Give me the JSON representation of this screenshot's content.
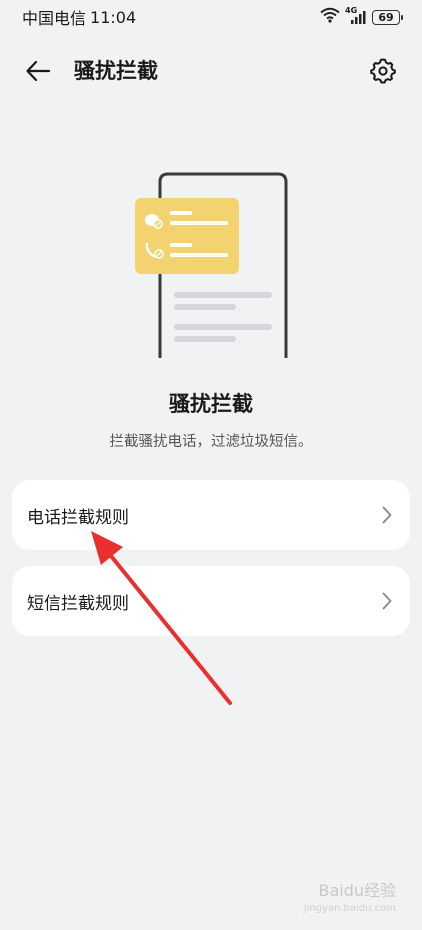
{
  "status_bar": {
    "carrier": "中国电信",
    "time": "11:04",
    "network": "4G",
    "battery": "69"
  },
  "app_bar": {
    "title": "骚扰拦截"
  },
  "hero": {
    "title": "骚扰拦截",
    "subtitle": "拦截骚扰电话，过滤垃圾短信。"
  },
  "menu": {
    "items": [
      {
        "label": "电话拦截规则"
      },
      {
        "label": "短信拦截规则"
      }
    ]
  },
  "watermark": {
    "brand": "Baidu经验",
    "url": "jingyan.baidu.com"
  },
  "colors": {
    "background": "#f1f2f4",
    "card": "#ffffff",
    "illustration_accent": "#f2d370",
    "annotation_arrow": "#e8312f"
  },
  "icons": [
    "back-arrow-icon",
    "gear-icon",
    "chevron-right-icon",
    "wifi-icon",
    "signal-icon",
    "battery-icon"
  ]
}
